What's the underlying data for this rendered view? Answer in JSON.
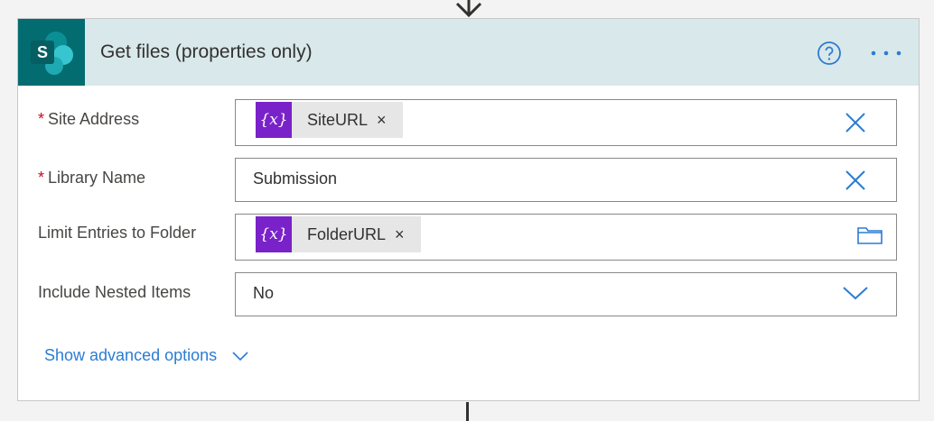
{
  "card": {
    "title": "Get files (properties only)",
    "app_icon": "sharepoint-icon",
    "app_letter": "S",
    "help_icon": "help-circle-icon",
    "more_icon": "more-ellipsis-icon"
  },
  "fields": {
    "site_address": {
      "required_mark": "*",
      "label": "Site Address",
      "token_glyph": "{x}",
      "token_value": "SiteURL",
      "token_remove": "×"
    },
    "library_name": {
      "required_mark": "*",
      "label": "Library Name",
      "value": "Submission"
    },
    "limit_folder": {
      "label": "Limit Entries to Folder",
      "token_glyph": "{x}",
      "token_value": "FolderURL",
      "token_remove": "×"
    },
    "nested_items": {
      "label": "Include Nested Items",
      "value": "No"
    }
  },
  "advanced": {
    "label": "Show advanced options"
  },
  "colors": {
    "accent": "#2b7cd3",
    "header_bg": "#d9e8ea",
    "app_tile": "#036c70",
    "token_icon": "#7a22c9",
    "required": "#c50f1f"
  }
}
